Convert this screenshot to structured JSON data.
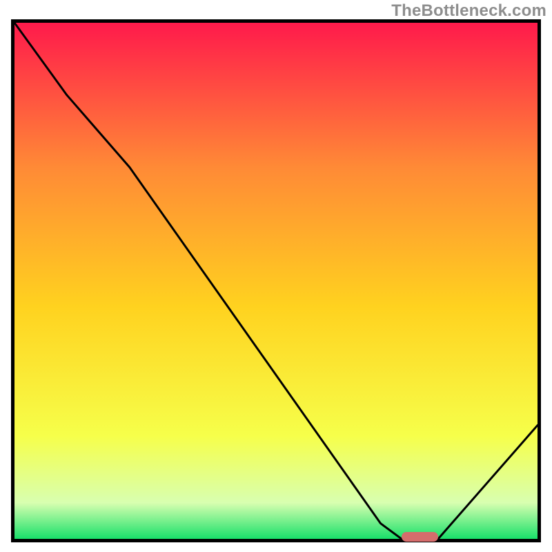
{
  "watermark": "TheBottleneck.com",
  "chart_data": {
    "type": "line",
    "title": "",
    "xlabel": "",
    "ylabel": "",
    "xlim": [
      0,
      100
    ],
    "ylim": [
      0,
      100
    ],
    "grid": false,
    "series": [
      {
        "name": "curve",
        "x": [
          0,
          10,
          22,
          70,
          74,
          81,
          100
        ],
        "y": [
          100,
          86,
          72,
          3,
          0,
          0,
          22
        ]
      }
    ],
    "annotations": [
      {
        "name": "optimum-marker",
        "x_start": 74,
        "x_end": 81,
        "y": 0
      }
    ],
    "background_gradient": {
      "top": "#ff1a4b",
      "upper_mid": "#ff8a36",
      "mid": "#ffd21f",
      "lower_mid": "#f6ff4a",
      "band": "#d8ffb0",
      "bottom": "#18e06a"
    }
  }
}
